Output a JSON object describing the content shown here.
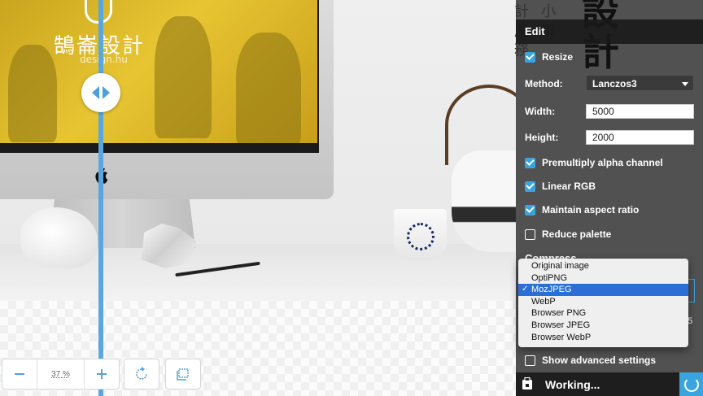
{
  "photo": {
    "logo_cn": "鵠崙設計",
    "logo_en": "design.hu",
    "overlay_small_chars": [
      "計",
      "小",
      "鳳",
      "事",
      "務"
    ],
    "overlay_big_chars": [
      "設",
      "計"
    ]
  },
  "viewer": {
    "zoom_value": "37 %",
    "zoom_out_icon": "minus-icon",
    "zoom_in_icon": "plus-icon",
    "rotate_icon": "rotate-icon",
    "fit_icon": "fit-screen-icon"
  },
  "panel": {
    "edit_header": "Edit",
    "resize_label": "Resize",
    "resize_checked": true,
    "method_label": "Method:",
    "method_value": "Lanczos3",
    "width_label": "Width:",
    "width_value": "5000",
    "height_label": "Height:",
    "height_value": "2000",
    "options": [
      {
        "label": "Premultiply alpha channel",
        "checked": true
      },
      {
        "label": "Linear RGB",
        "checked": true
      },
      {
        "label": "Maintain aspect ratio",
        "checked": true
      },
      {
        "label": "Reduce palette",
        "checked": false
      }
    ],
    "compress_header": "Compress",
    "compress_options": [
      "Original image",
      "OptiPNG",
      "MozJPEG",
      "WebP",
      "Browser PNG",
      "Browser JPEG",
      "Browser WebP"
    ],
    "compress_selected": "MozJPEG",
    "edge_fragment": "5",
    "advanced_label": "Show advanced settings",
    "advanced_checked": false,
    "status_text": "Working...",
    "accent_color": "#3aa4de"
  }
}
